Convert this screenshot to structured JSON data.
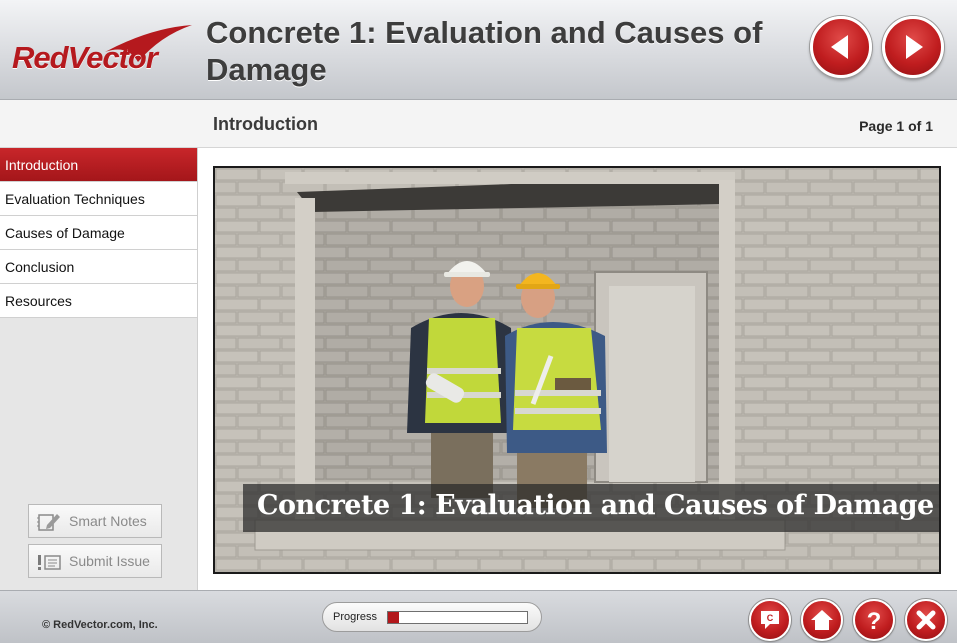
{
  "header": {
    "logo_text": "RedVector",
    "course_title": "Concrete 1: Evaluation and Causes of Damage",
    "back_icon": "left-arrow-icon",
    "next_icon": "right-arrow-icon"
  },
  "subheader": {
    "section_title": "Introduction",
    "page_indicator": "Page 1 of 1"
  },
  "sidebar": {
    "items": [
      {
        "label": "Introduction",
        "active": true
      },
      {
        "label": "Evaluation Techniques",
        "active": false
      },
      {
        "label": "Causes of Damage",
        "active": false
      },
      {
        "label": "Conclusion",
        "active": false
      },
      {
        "label": "Resources",
        "active": false
      }
    ],
    "smart_notes_label": "Smart Notes",
    "submit_issue_label": "Submit Issue"
  },
  "slide": {
    "caption": "Concrete 1: Evaluation and Causes of Damage"
  },
  "footer": {
    "copyright": "© RedVector.com, Inc.",
    "progress_label": "Progress",
    "progress_fraction": 0.08,
    "buttons": [
      "closed-caption-icon",
      "home-icon",
      "help-icon",
      "exit-icon"
    ]
  },
  "colors": {
    "brand_red": "#c01d1f",
    "active_menu": "#b51e22",
    "header_bg": "#d9dbdf"
  }
}
